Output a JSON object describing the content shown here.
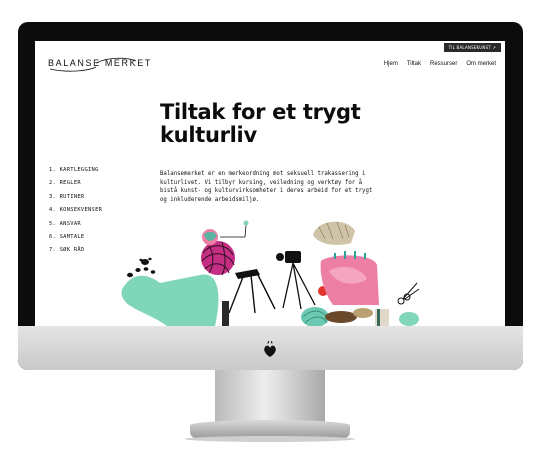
{
  "site": {
    "logo_text": "BALANSE MERKET",
    "badge": "TIL BALANSEKUNST ↗",
    "nav": [
      {
        "label": "Hjem"
      },
      {
        "label": "Tiltak"
      },
      {
        "label": "Ressurser"
      },
      {
        "label": "Om merket"
      }
    ]
  },
  "hero": {
    "title": "Tiltak for et trygt kulturliv",
    "intro": "Balansemerket er en merkeordning mot seksuell trakassering i kulturlivet. Vi tilbyr kursing, veiledning og verktøy for å bistå kunst- og kulturvirksomheter i deres arbeid for et trygt og inkluderende arbeidsmiljø."
  },
  "steps": [
    {
      "label": "1. KARTLEGGING"
    },
    {
      "label": "2. REGLER"
    },
    {
      "label": "3. RUTINER"
    },
    {
      "label": "4. KONSEKVENSER"
    },
    {
      "label": "5. ANSVAR"
    },
    {
      "label": "6. SAMTALE"
    },
    {
      "label": "7. SØK RÅD"
    }
  ],
  "icons": {
    "monitor_logo": "leaf-logo-icon"
  },
  "colors": {
    "mint": "#7fd6b8",
    "magenta": "#d23a8c",
    "pink": "#ee7fa4",
    "bezel": "#0c0c0c"
  }
}
